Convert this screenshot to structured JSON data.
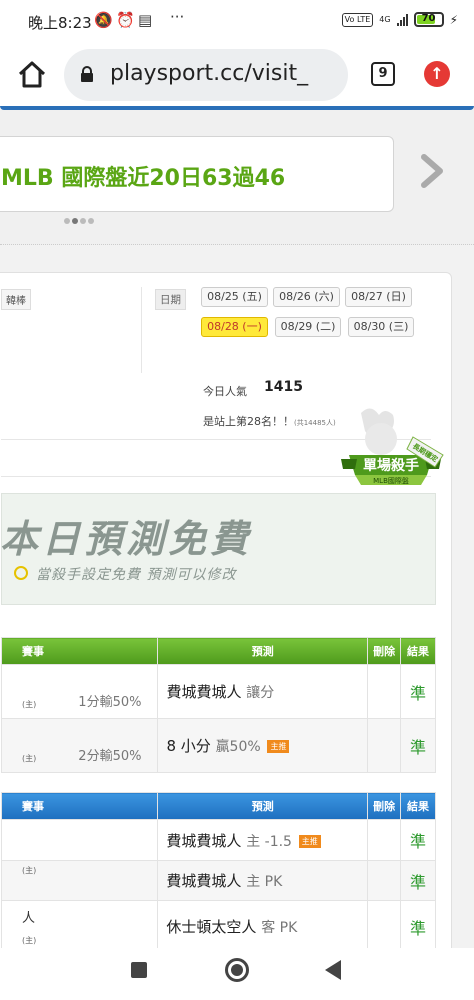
{
  "status_bar": {
    "time": "晚上8:23",
    "more": "···",
    "network": "4G",
    "volte": "Vo LTE",
    "battery": "70"
  },
  "browser": {
    "url": "playsport.cc/visit_",
    "tab_count": "9"
  },
  "banner": {
    "text": "MLB 國際盤近20日63過46"
  },
  "info": {
    "category": "韓棒",
    "date_label": "日期",
    "dates": [
      "08/25 (五)",
      "08/26 (六)",
      "08/27 (日)",
      "08/28 (一)",
      "08/29 (二)",
      "08/30 (三)"
    ],
    "active_date": "08/28 (一)",
    "popularity_label": "今日人氣",
    "popularity_value": "1415",
    "rank_text": "是站上第28名！！",
    "rank_total": "(共14485人)"
  },
  "badge": {
    "title": "單場殺手",
    "subtitle": "MLB國際盤",
    "ribbon": "長期穩定"
  },
  "free": {
    "title": "本日預測免費",
    "subtitle": "當殺手設定免費  預測可以修改"
  },
  "table_headers": {
    "event": "賽事",
    "prediction": "預測",
    "delete": "刪除",
    "result": "結果"
  },
  "green_rows": [
    {
      "home": "(主)",
      "loss": "1分輸50%",
      "team": "費城費城人",
      "type": "讓分",
      "tag": "",
      "result": "準"
    },
    {
      "home": "(主)",
      "loss": "2分輸50%",
      "team": "8 小分",
      "type": "贏50%",
      "tag": "主推",
      "result": "準"
    }
  ],
  "blue_rows": [
    {
      "event": "",
      "home": "",
      "team": "費城費城人",
      "type": "主 -1.5",
      "tag": "主推",
      "result": "準"
    },
    {
      "event": "",
      "home": "(主)",
      "team": "費城費城人",
      "type": "主 PK",
      "tag": "",
      "result": "準"
    },
    {
      "event": "人",
      "home": "(主)",
      "team": "休士頓太空人",
      "type": "客 PK",
      "tag": "",
      "result": "準"
    }
  ]
}
